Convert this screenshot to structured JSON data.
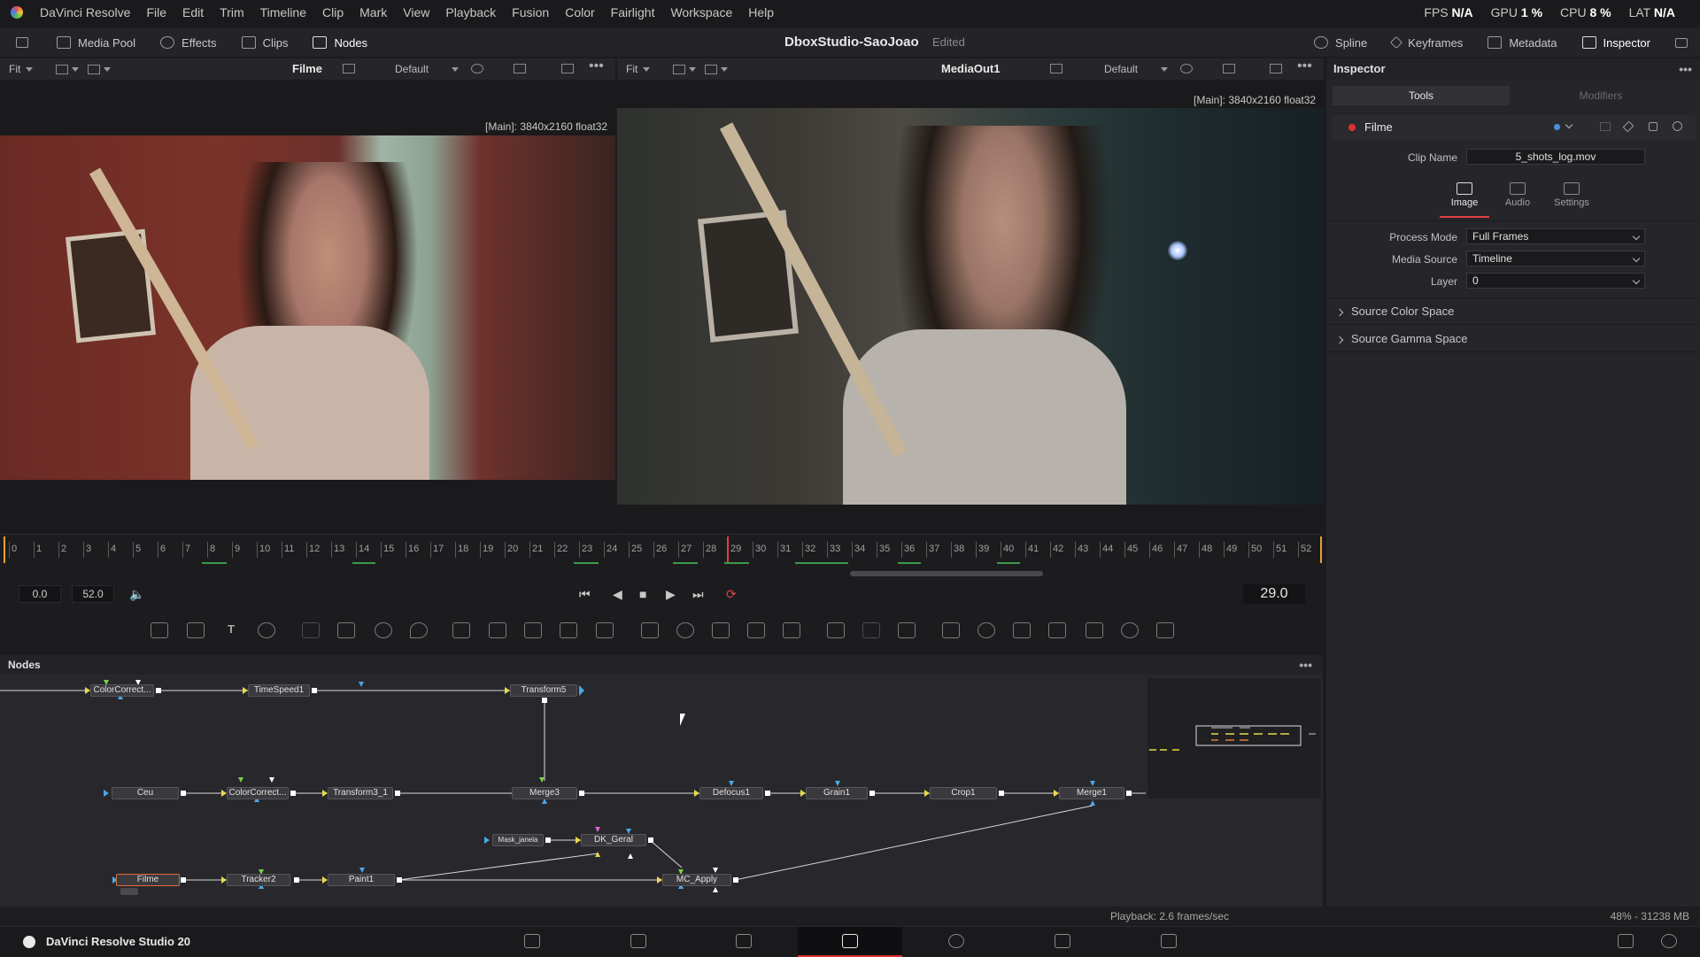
{
  "app": {
    "name": "DaVinci Resolve",
    "menu": [
      "File",
      "Edit",
      "Trim",
      "Timeline",
      "Clip",
      "Mark",
      "View",
      "Playback",
      "Fusion",
      "Color",
      "Fairlight",
      "Workspace",
      "Help"
    ]
  },
  "stats": {
    "fps_label": "FPS",
    "fps_value": "N/A",
    "gpu_label": "GPU",
    "gpu_value": "1 %",
    "cpu_label": "CPU",
    "cpu_value": "8 %",
    "lat_label": "LAT",
    "lat_value": "N/A"
  },
  "toolbar": {
    "media_pool": "Media Pool",
    "effects": "Effects",
    "clips": "Clips",
    "nodes": "Nodes",
    "spline": "Spline",
    "keyframes": "Keyframes",
    "metadata": "Metadata",
    "inspector": "Inspector"
  },
  "project": {
    "title": "DboxStudio-SaoJoao",
    "status": "Edited"
  },
  "viewer_left": {
    "fit": "Fit",
    "title": "Filme",
    "lut": "Default",
    "info": "[Main]: 3840x2160 float32"
  },
  "viewer_right": {
    "fit": "Fit",
    "title": "MediaOut1",
    "lut": "Default",
    "info": "[Main]: 3840x2160 float32"
  },
  "timeline": {
    "ticks": [
      "0",
      "1",
      "2",
      "3",
      "4",
      "5",
      "6",
      "7",
      "8",
      "9",
      "10",
      "11",
      "12",
      "13",
      "14",
      "15",
      "16",
      "17",
      "18",
      "19",
      "20",
      "21",
      "22",
      "23",
      "24",
      "25",
      "26",
      "27",
      "28",
      "29",
      "30",
      "31",
      "32",
      "33",
      "34",
      "35",
      "36",
      "37",
      "38",
      "39",
      "40",
      "41",
      "42",
      "43",
      "44",
      "45",
      "46",
      "47",
      "48",
      "49",
      "50",
      "51",
      "52"
    ],
    "start": "0.0",
    "end": "52.0",
    "current_frame": "29.0",
    "playhead_frame": 29
  },
  "nodes_panel": {
    "title": "Nodes",
    "nodes": {
      "colorcorrect_top": "ColorCorrect...",
      "timespeed1": "TimeSpeed1",
      "transform5": "Transform5",
      "ceu": "Ceu",
      "colorcorrect_mid": "ColorCorrect...",
      "transform3_1": "Transform3_1",
      "merge3": "Merge3",
      "defocus1": "Defocus1",
      "grain1": "Grain1",
      "crop1": "Crop1",
      "merge1": "Merge1",
      "mask_janela": "Mask_janela",
      "dk_geral": "DK_Geral",
      "filme": "Filme",
      "tracker2": "Tracker2",
      "paint1": "Paint1",
      "mc_apply": "MC_Apply"
    }
  },
  "inspector": {
    "title": "Inspector",
    "tab_tools": "Tools",
    "tab_modifiers": "Modifiers",
    "node_name": "Filme",
    "clip_name_label": "Clip Name",
    "clip_name_value": "5_shots_log.mov",
    "subtab_image": "Image",
    "subtab_audio": "Audio",
    "subtab_settings": "Settings",
    "process_mode_label": "Process Mode",
    "process_mode_value": "Full Frames",
    "media_source_label": "Media Source",
    "media_source_value": "Timeline",
    "layer_label": "Layer",
    "layer_value": "0",
    "section_color": "Source Color Space",
    "section_gamma": "Source Gamma Space"
  },
  "status": {
    "playback": "Playback: 2.6 frames/sec",
    "memory": "48% - 31238 MB"
  },
  "footer": {
    "product": "DaVinci Resolve Studio 20"
  }
}
